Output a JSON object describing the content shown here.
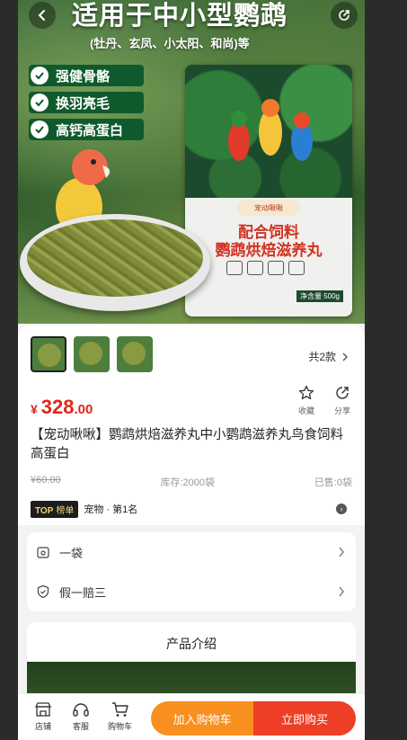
{
  "hero": {
    "title": "适用于中小型鹦鹉",
    "subtitle": "(牡丹、玄凤、小太阳、和尚)等",
    "features": [
      "强健骨骼",
      "换羽亮毛",
      "高钙高蛋白"
    ],
    "bag": {
      "brand": "宠动啾啾",
      "name_line1": "配合饲料",
      "name_line2": "鹦鹉烘焙滋养丸",
      "net_weight": "净含量 500g"
    }
  },
  "gallery": {
    "variants_label": "共2款"
  },
  "price": {
    "currency": "¥",
    "integer": "328",
    "decimal": ".00"
  },
  "actions": {
    "favorite": "收藏",
    "share": "分享"
  },
  "product": {
    "title": "【宠动啾啾】鹦鹉烘焙滋养丸中小鹦鹉滋养丸鸟食饲料高蛋白",
    "original_price": "¥60.00",
    "stock": "库存:2000袋",
    "sold": "已售:0袋"
  },
  "rank": {
    "badge_top": "TOP",
    "badge_label": "榜单",
    "text": "宠物 · 第1名"
  },
  "options": {
    "spec": "一袋",
    "guarantee": "假一赔三"
  },
  "intro": {
    "heading": "产品介绍"
  },
  "bottom_bar": {
    "store": "店铺",
    "service": "客服",
    "cart": "购物车",
    "add_to_cart": "加入购物车",
    "buy_now": "立即购买"
  },
  "colors": {
    "price_red": "#e2251a",
    "cart_orange": "#f7901e",
    "buy_red": "#ee3e25"
  }
}
